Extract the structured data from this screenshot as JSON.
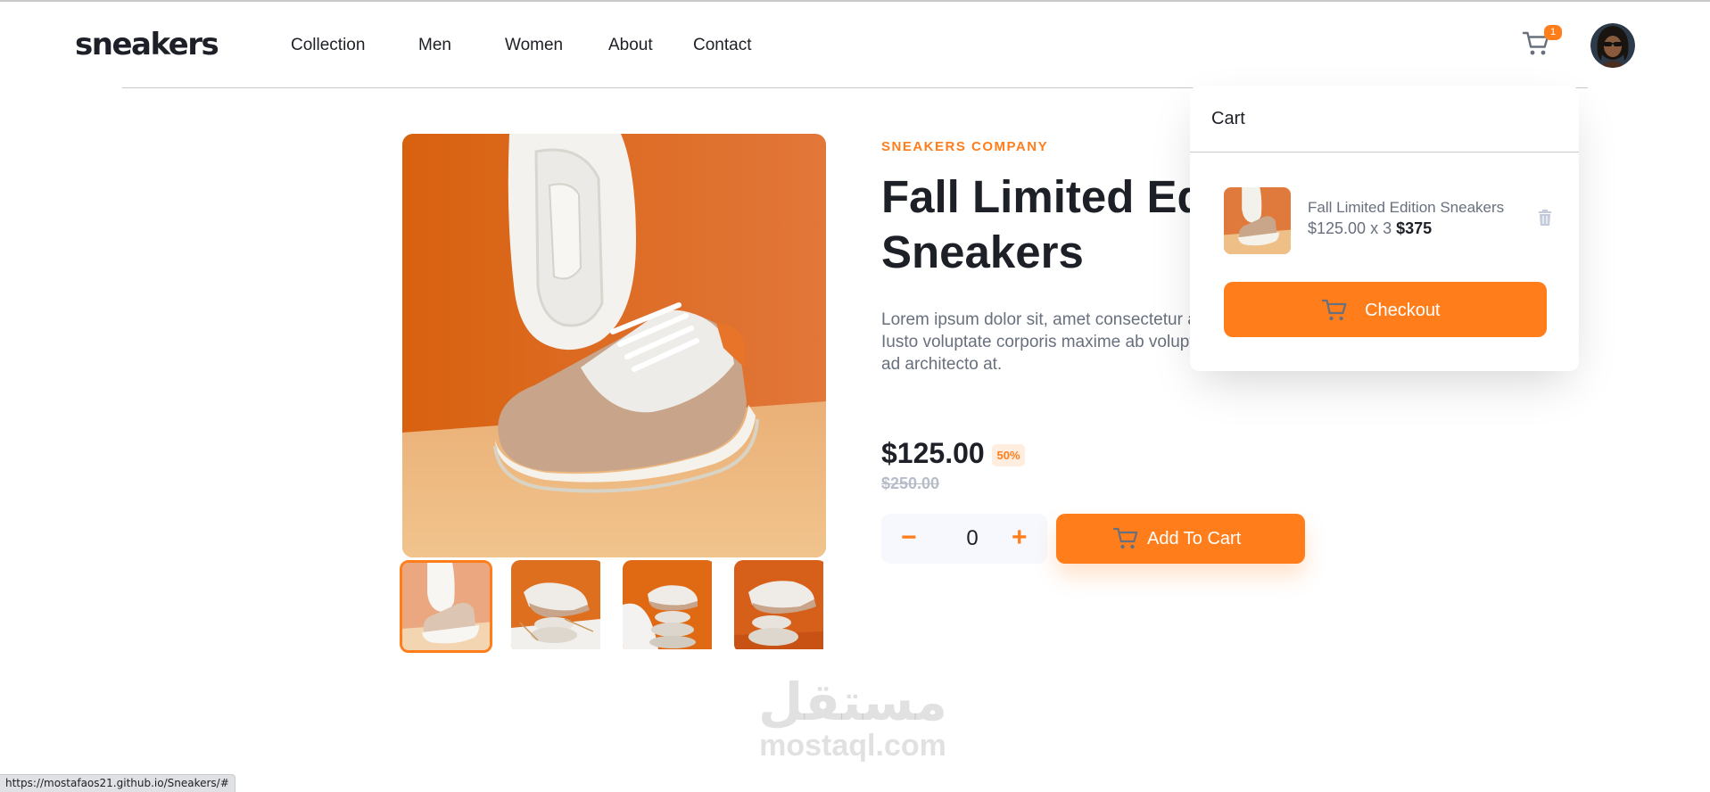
{
  "header": {
    "logo": "sneakers",
    "nav": [
      "Collection",
      "Men",
      "Women",
      "About",
      "Contact"
    ],
    "cart_count": "1",
    "cart_icon": "cart-icon",
    "avatar_icon": "avatar-icon"
  },
  "gallery": {
    "main_image": "sneaker-product-image",
    "thumbnails": [
      "thumbnail-1",
      "thumbnail-2",
      "thumbnail-3",
      "thumbnail-4"
    ],
    "active_thumbnail": 0
  },
  "product": {
    "company": "SNEAKERS COMPANY",
    "title": "Fall Limited Edition Sneakers",
    "description": "Lorem ipsum dolor sit, amet consectetur adipisicing elit. Iusto voluptate corporis maxime ab voluptatem temporibus ad architecto at.",
    "price": "$125.00",
    "discount": "50%",
    "old_price": "$250.00",
    "quantity": "0",
    "minus_label": "−",
    "plus_label": "+",
    "add_to_cart_label": "Add To Cart"
  },
  "cart": {
    "title": "Cart",
    "item_name": "Fall Limited Edition Sneakers",
    "item_calc": "$125.00 x 3 ",
    "item_total": "$375",
    "checkout_label": "Checkout",
    "delete_icon": "trash-icon"
  },
  "watermark": {
    "arabic": "مستقل",
    "latin": "mostaql.com"
  },
  "status_url": "https://mostafaos21.github.io/Sneakers/#",
  "colors": {
    "accent": "#ff7e1b",
    "accent_pale": "#ffede0",
    "text_dark": "#1d2026",
    "text_gray": "#68707d"
  }
}
